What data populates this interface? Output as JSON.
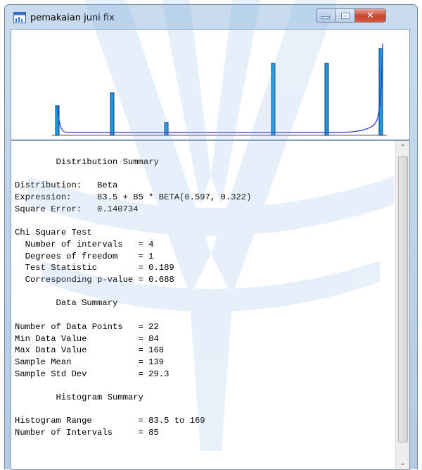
{
  "window": {
    "title": "pemakaian juni fix"
  },
  "controls": {
    "close_glyph": "✕"
  },
  "histogram": {
    "bar_color": "#1a9be0",
    "curve_color": "#2f2fd0",
    "bars": [
      {
        "interval": 1,
        "relative_height": 0.3
      },
      {
        "interval": 2,
        "relative_height": 0.43
      },
      {
        "interval": 3,
        "relative_height": 0.13
      },
      {
        "interval": 4,
        "relative_height": 0.73
      },
      {
        "interval": 5,
        "relative_height": 0.73
      },
      {
        "interval": 6,
        "relative_height": 0.88
      }
    ]
  },
  "report": {
    "lines": [
      "        Distribution Summary",
      "",
      "Distribution:   Beta",
      "Expression:     83.5 + 85 * BETA(0.597, 0.322)",
      "Square Error:   0.140734",
      "",
      "Chi Square Test",
      "  Number of intervals   = 4",
      "  Degrees of freedom    = 1",
      "  Test Statistic        = 0.189",
      "  Corresponding p-value = 0.688",
      "",
      "        Data Summary",
      "",
      "Number of Data Points   = 22",
      "Min Data Value          = 84",
      "Max Data Value          = 168",
      "Sample Mean             = 139",
      "Sample Std Dev          = 29.3",
      "",
      "        Histogram Summary",
      "",
      "Histogram Range         = 83.5 to 169",
      "Number of Intervals     = 85"
    ]
  },
  "scroll": {
    "up_glyph": "⌃",
    "down_glyph": "⌄"
  }
}
